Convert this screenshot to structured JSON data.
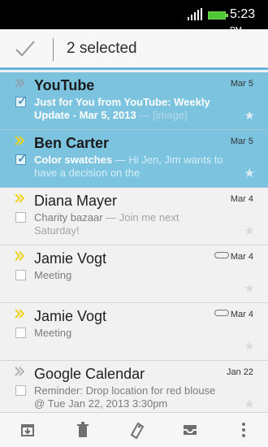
{
  "status_bar": {
    "time": "5:23",
    "ampm": "PM",
    "signal_icon": "signal-icon",
    "battery_icon": "battery-icon"
  },
  "action_bar": {
    "selected_text": "2 selected",
    "done_icon": "check-icon"
  },
  "emails": [
    {
      "sender": "YouTube",
      "date": "Mar 5",
      "subject": "Just for You from YouTube: Weekly Update - Mar 5, 2013",
      "excerpt": "",
      "attachment": "[image]",
      "selected": true,
      "important": true
    },
    {
      "sender": "Ben Carter",
      "date": "Mar 5",
      "subject": "Color swatches",
      "excerpt": "Hi Jen, Jim wants to have a decision on the",
      "attachment": "",
      "selected": true,
      "important": true
    },
    {
      "sender": "Diana Mayer",
      "date": "Mar 4",
      "subject": "Charity bazaar",
      "excerpt": "Join me next Saturday!",
      "attachment": "",
      "selected": false,
      "important": true
    },
    {
      "sender": "Jamie Vogt",
      "date": "Mar 4",
      "subject": "Meeting",
      "excerpt": "",
      "attachment": "",
      "selected": false,
      "important": true,
      "has_attachment_icon": true
    },
    {
      "sender": "Jamie Vogt",
      "date": "Mar 4",
      "subject": "Meeting",
      "excerpt": "",
      "attachment": "",
      "selected": false,
      "important": true,
      "has_attachment_icon": true
    },
    {
      "sender": "Google Calendar",
      "date": "Jan 22",
      "subject": "Reminder: Drop location for red blouse @ Tue Jan 22, 2013 3:30pm",
      "excerpt": "",
      "attachment": "",
      "selected": false,
      "important": false
    }
  ],
  "bottom_actions": [
    {
      "name": "archive",
      "icon": "archive-icon"
    },
    {
      "name": "delete",
      "icon": "trash-icon"
    },
    {
      "name": "label",
      "icon": "tag-icon"
    },
    {
      "name": "move",
      "icon": "inbox-icon"
    },
    {
      "name": "more",
      "icon": "more-vertical-icon"
    }
  ],
  "colors": {
    "selected_row": "#7bc3df",
    "accent": "#66b4e1",
    "important_marker": "#f1d21f"
  }
}
